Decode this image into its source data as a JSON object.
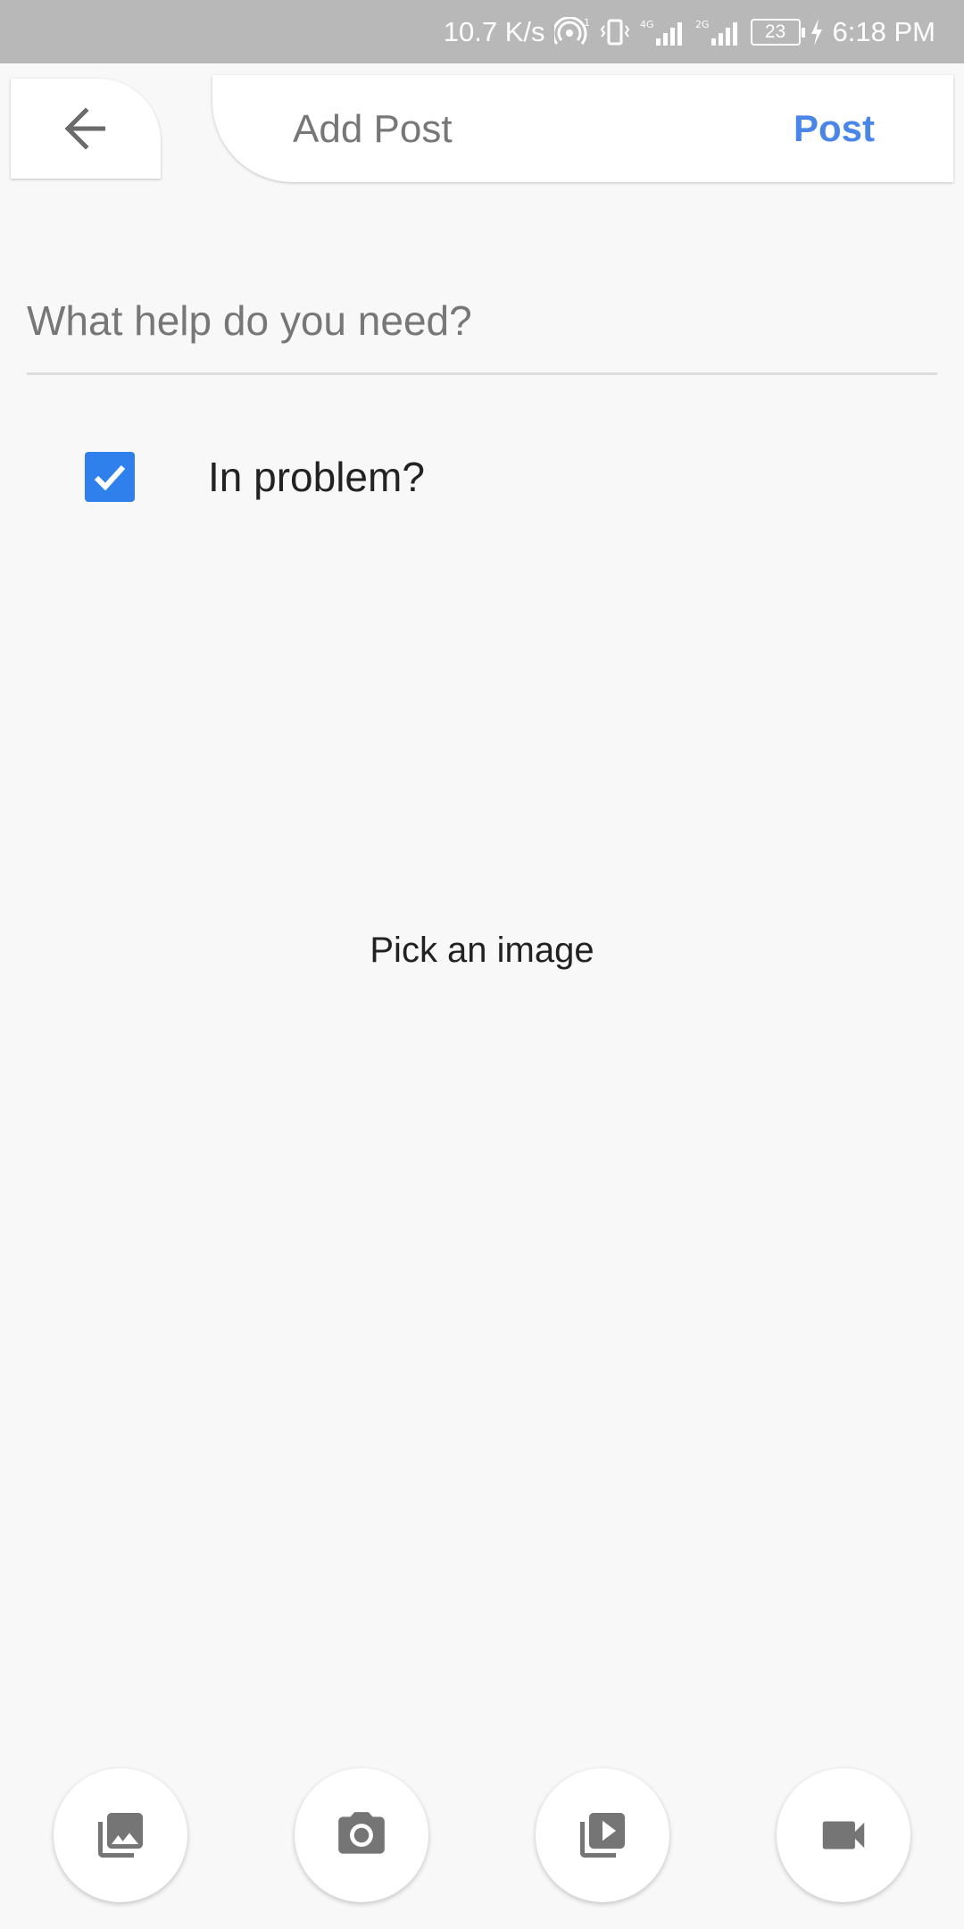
{
  "status_bar": {
    "speed": "10.7 K/s",
    "network_4g": "4G",
    "network_2g": "2G",
    "battery": "23",
    "time": "6:18 PM"
  },
  "header": {
    "title": "Add Post",
    "post_label": "Post"
  },
  "input": {
    "placeholder": "What help do you need?",
    "value": ""
  },
  "checkbox": {
    "label": "In problem?",
    "checked": true
  },
  "image_area": {
    "text": "Pick an image"
  },
  "bottom_actions": [
    {
      "icon": "photo-library-icon"
    },
    {
      "icon": "camera-icon"
    },
    {
      "icon": "video-library-icon"
    },
    {
      "icon": "videocam-icon"
    }
  ],
  "colors": {
    "accent": "#4a86e8",
    "checkbox": "#2f80ed",
    "status_bar": "#b8b8b8",
    "background": "#f8f8f8"
  }
}
